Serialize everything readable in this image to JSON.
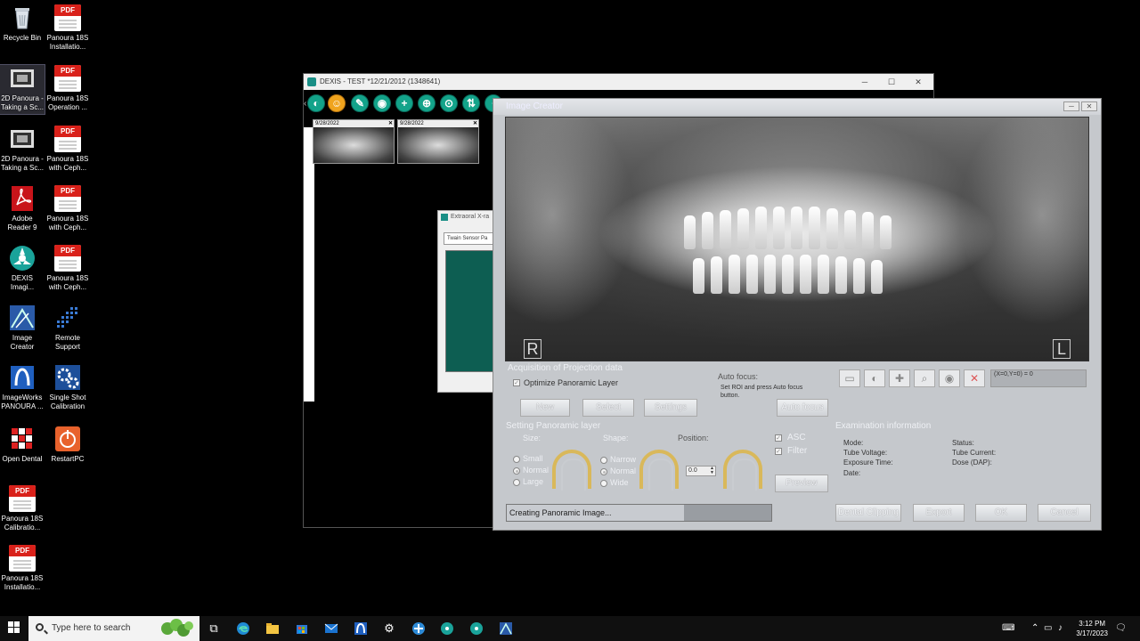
{
  "desktop": {
    "icons": [
      {
        "label": "Recycle Bin"
      },
      {
        "label": "Panoura 18S Installatio..."
      },
      {
        "label": "2D Panoura - Taking a Sc..."
      },
      {
        "label": "Panoura 18S Operation ..."
      },
      {
        "label": "2D Panoura - Taking a Sc..."
      },
      {
        "label": "Panoura 18S with Ceph..."
      },
      {
        "label": "Adobe Reader 9"
      },
      {
        "label": "Panoura 18S with Ceph..."
      },
      {
        "label": "DEXIS Imagi..."
      },
      {
        "label": "Panoura 18S with Ceph..."
      },
      {
        "label": "Image Creator"
      },
      {
        "label": "Remote Support"
      },
      {
        "label": "ImageWorks PANOURA ..."
      },
      {
        "label": "Single Shot Calibration"
      },
      {
        "label": "Open Dental"
      },
      {
        "label": "RestartPC"
      },
      {
        "label": "Panoura 18S Calibratio..."
      },
      {
        "label": "Panoura 18S Installatio..."
      }
    ],
    "pdf_badge": "PDF"
  },
  "dexis": {
    "title": "DEXIS - TEST *12/21/2012 (1348641)",
    "thumbnails": [
      {
        "date": "9/28/2022"
      },
      {
        "date": "9/28/2022"
      }
    ],
    "close_glyph": "✕"
  },
  "extraoral": {
    "title": "Extraoral X-ra",
    "sensor": "Twain Sensor Pa"
  },
  "image_creator": {
    "title": "Image Creator",
    "xray_markers": {
      "right": "R",
      "left": "L"
    },
    "acquisition": {
      "heading": "Acquisition of Projection data",
      "optimize_label": "Optimize Panoramic Layer",
      "new_label": "New",
      "select_label": "Select",
      "settings_label": "Settings"
    },
    "autofocus": {
      "heading": "Auto focus:",
      "instructions": "Set ROI and press Auto focus button.",
      "button_label": "Auto focus"
    },
    "tools": {
      "coord_readout": "(X=0,Y=0) = 0"
    },
    "panoramic_layer": {
      "heading": "Setting Panoramic layer",
      "size_label": "Size:",
      "size_options": [
        "Small",
        "Normal",
        "Large"
      ],
      "size_selected": "Normal",
      "shape_label": "Shape:",
      "shape_options": [
        "Narrow",
        "Normal",
        "Wide"
      ],
      "shape_selected": "Normal",
      "position_label": "Position:",
      "position_value": "0.0",
      "asc_label": "ASC",
      "filter_label": "Filter",
      "preview_label": "Preview"
    },
    "exam_info": {
      "heading": "Examination information",
      "mode": "Mode:",
      "tube_voltage": "Tube Voltage:",
      "exposure_time": "Exposure Time:",
      "date": "Date:",
      "status": "Status:",
      "tube_current": "Tube Current:",
      "dose": "Dose (DAP):"
    },
    "progress": {
      "text": "Creating Panoramic Image...",
      "fraction": 0.67
    },
    "buttons": {
      "dental_clipping": "Dental Clipping",
      "export": "Export",
      "ok": "OK",
      "cancel": "Cancel"
    }
  },
  "taskbar": {
    "search_placeholder": "Type here to search",
    "time": "3:12 PM",
    "date": "3/17/2023"
  }
}
